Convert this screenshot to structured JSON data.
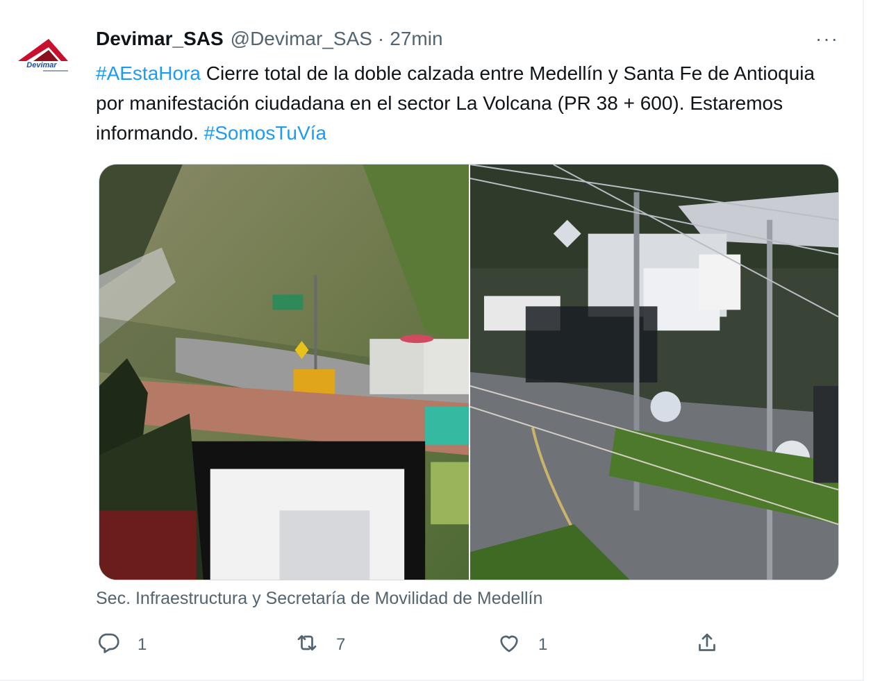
{
  "tweet": {
    "display_name": "Devimar_SAS",
    "handle": "@Devimar_SAS",
    "separator": "·",
    "time": "27min",
    "more_label": "···",
    "text": {
      "hashtag_1": "#AEstaHora",
      "body": " Cierre total de la doble calzada entre Medellín y Santa Fe de Antioquia por manifestación ciudadana en el sector La Volcana (PR 38 + 600). Estaremos informando. ",
      "hashtag_2": "#SomosTuVía"
    },
    "media_caption": "Sec. Infraestructura y Secretaría de Movilidad de Medellín",
    "avatar_logo_text": "Devimar",
    "actions": {
      "reply": {
        "icon": "reply-icon",
        "count": "1"
      },
      "retweet": {
        "icon": "retweet-icon",
        "count": "7"
      },
      "like": {
        "icon": "heart-icon",
        "count": "1"
      },
      "share": {
        "icon": "share-icon"
      }
    }
  },
  "colors": {
    "link": "#1d9bf0",
    "secondary_text": "#536471",
    "logo_red": "#c8102e",
    "logo_blue": "#1f4ea1"
  }
}
